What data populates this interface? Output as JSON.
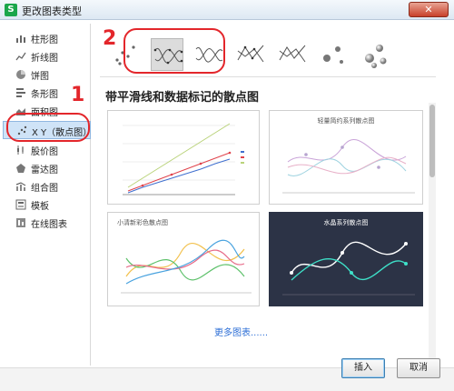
{
  "window": {
    "title": "更改图表类型",
    "app_icon": "S"
  },
  "sidebar": {
    "items": [
      {
        "label": "柱形图",
        "icon": "column-chart-icon"
      },
      {
        "label": "折线图",
        "icon": "line-chart-icon"
      },
      {
        "label": "饼图",
        "icon": "pie-chart-icon"
      },
      {
        "label": "条形图",
        "icon": "bar-chart-icon"
      },
      {
        "label": "面积图",
        "icon": "area-chart-icon"
      },
      {
        "label": "X Y（散点图）",
        "icon": "scatter-chart-icon",
        "selected": true
      },
      {
        "label": "股价图",
        "icon": "stock-chart-icon"
      },
      {
        "label": "雷达图",
        "icon": "radar-chart-icon"
      },
      {
        "label": "组合图",
        "icon": "combo-chart-icon"
      },
      {
        "label": "模板",
        "icon": "template-icon"
      },
      {
        "label": "在线图表",
        "icon": "online-chart-icon"
      }
    ]
  },
  "annotations": {
    "num1": "1",
    "num2": "2"
  },
  "subtypes": {
    "items": [
      {
        "name": "scatter",
        "selected": false
      },
      {
        "name": "smooth-lines-markers",
        "selected": true
      },
      {
        "name": "smooth-lines",
        "selected": false
      },
      {
        "name": "straight-lines-markers",
        "selected": false
      },
      {
        "name": "straight-lines",
        "selected": false
      },
      {
        "name": "bubble",
        "selected": false
      },
      {
        "name": "bubble-3d",
        "selected": false
      }
    ]
  },
  "section_title": "带平滑线和数据标记的散点图",
  "thumbs": {
    "t1": {
      "title": ""
    },
    "t2": {
      "title": "轻量简约系列散点图"
    },
    "t3": {
      "title": "小清新彩色散点图"
    },
    "t4": {
      "title": "水晶系列散点图"
    }
  },
  "more_link": "更多图表......",
  "buttons": {
    "ok": "插入",
    "cancel": "取消"
  },
  "colors": {
    "accent": "#e3262b",
    "selection": "#cfe3f7",
    "link": "#2e6fd6"
  }
}
